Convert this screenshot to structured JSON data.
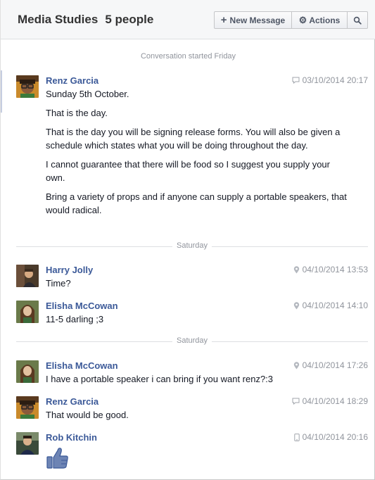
{
  "header": {
    "title": "Media Studies",
    "people_count": "5 people",
    "new_message_label": "New Message",
    "actions_label": "Actions"
  },
  "conversation_started": "Conversation started Friday",
  "day_separators": [
    "Saturday",
    "Saturday"
  ],
  "messages": [
    {
      "sender": "Renz Garcia",
      "source_icon": "chat-icon",
      "timestamp": "03/10/2014 20:17",
      "paragraphs": [
        "Sunday 5th October.",
        "That is the day.",
        "That is the day you will be signing release forms. You will also be given a schedule which states what you will be doing throughout the day.",
        "I cannot guarantee that there will be food so I suggest you supply your own.",
        "Bring a variety of props and if anyone can supply a portable speakers, that would radical."
      ]
    },
    {
      "sender": "Harry Jolly",
      "source_icon": "location-pin-icon",
      "timestamp": "04/10/2014 13:53",
      "paragraphs": [
        "Time?"
      ]
    },
    {
      "sender": "Elisha McCowan",
      "source_icon": "location-pin-icon",
      "timestamp": "04/10/2014 14:10",
      "paragraphs": [
        "11-5 darling ;3"
      ]
    },
    {
      "sender": "Elisha McCowan",
      "source_icon": "location-pin-icon",
      "timestamp": "04/10/2014 17:26",
      "paragraphs": [
        "I have a portable speaker i can bring if you want renz?:3"
      ]
    },
    {
      "sender": "Renz Garcia",
      "source_icon": "chat-icon",
      "timestamp": "04/10/2014 18:29",
      "paragraphs": [
        "That would be good."
      ]
    },
    {
      "sender": "Rob Kitchin",
      "source_icon": "mobile-phone-icon",
      "timestamp": "04/10/2014 20:16",
      "sticker": "thumbs-up-sticker"
    }
  ],
  "colors": {
    "link_blue": "#3b5998",
    "meta_gray": "#90949c",
    "like_blue": "#6d84b4"
  }
}
